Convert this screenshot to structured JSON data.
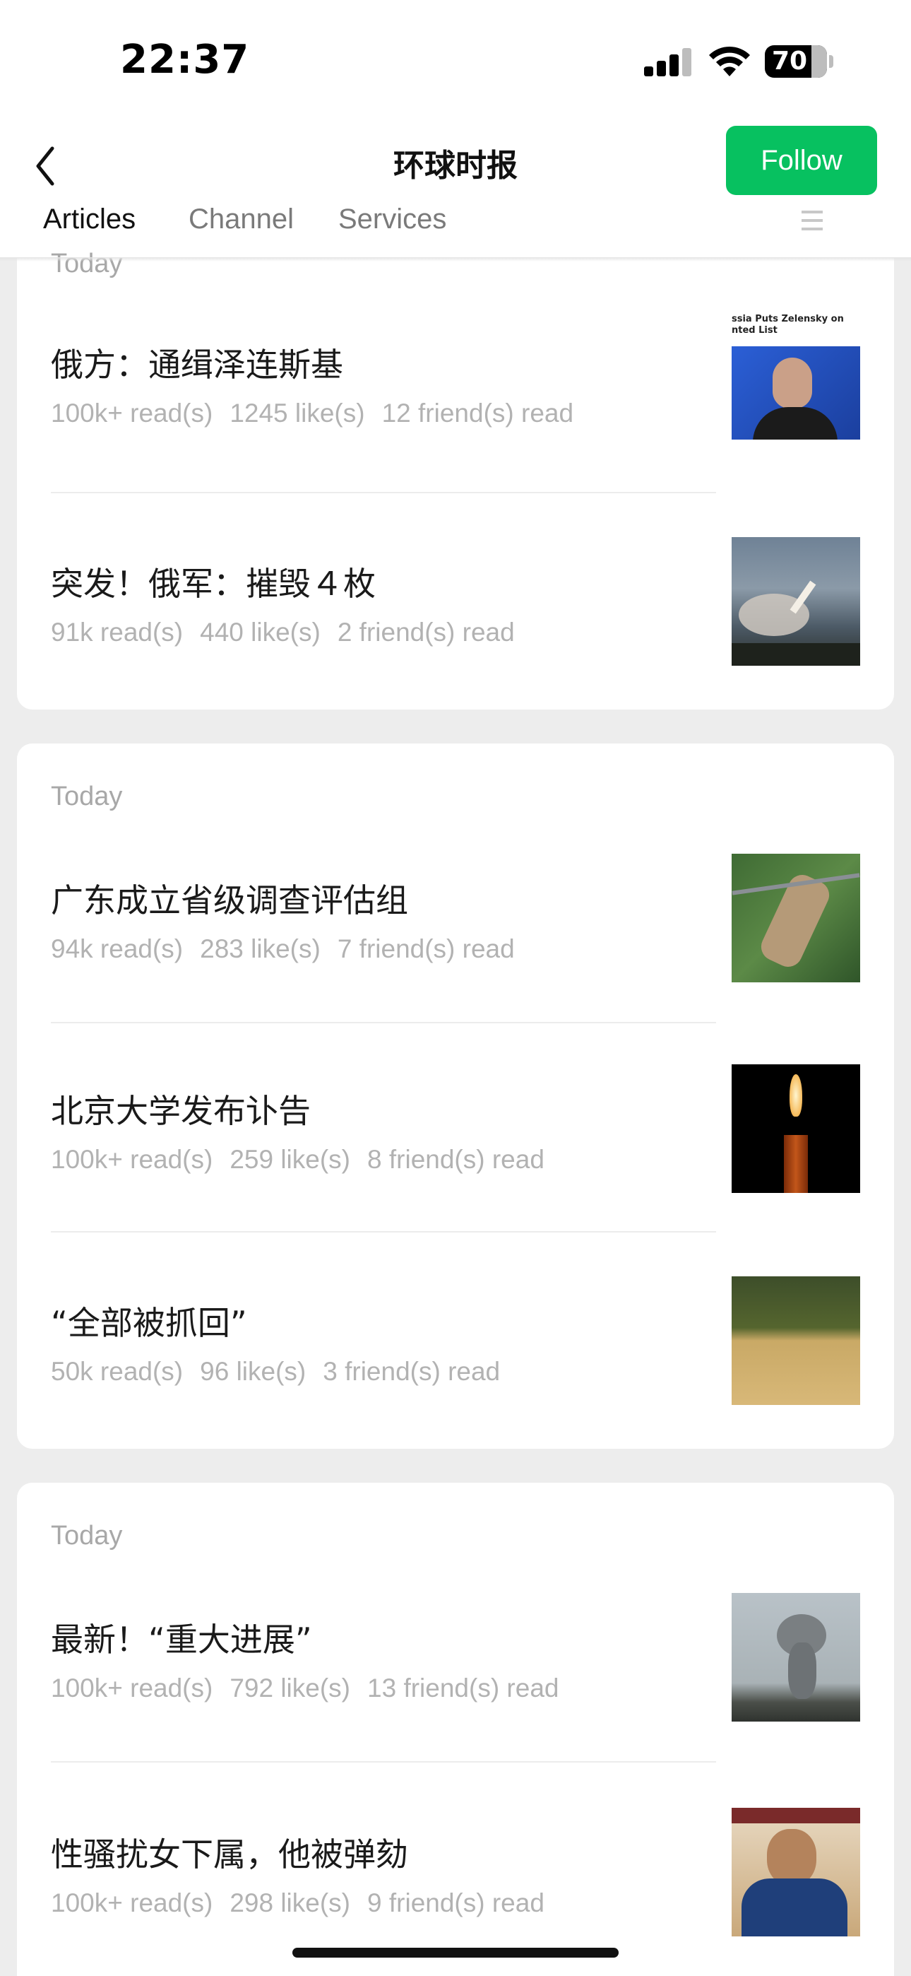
{
  "status": {
    "time": "22:37",
    "battery": "70"
  },
  "nav": {
    "title": "环球时报",
    "follow_label": "Follow",
    "tabs": [
      {
        "label": "Articles"
      },
      {
        "label": "Channel"
      },
      {
        "label": "Services"
      }
    ]
  },
  "groups": [
    {
      "label": "Today",
      "articles": [
        {
          "title": "俄方：通缉泽连斯基",
          "reads": "100k+ read(s)",
          "likes": "1245 like(s)",
          "friends": "12 friend(s) read",
          "thumb_caption": "ssia Puts Zelensky on\nnted List"
        },
        {
          "title": "突发！俄军：摧毁４枚",
          "reads": "91k read(s)",
          "likes": "440 like(s)",
          "friends": "2 friend(s) read"
        }
      ]
    },
    {
      "label": "Today",
      "articles": [
        {
          "title": "广东成立省级调查评估组",
          "reads": "94k read(s)",
          "likes": "283 like(s)",
          "friends": "7 friend(s) read"
        },
        {
          "title": "北京大学发布讣告",
          "reads": "100k+ read(s)",
          "likes": "259 like(s)",
          "friends": "8 friend(s) read"
        },
        {
          "title": "“全部被抓回”",
          "reads": "50k read(s)",
          "likes": "96 like(s)",
          "friends": "3 friend(s) read"
        }
      ]
    },
    {
      "label": "Today",
      "articles": [
        {
          "title": "最新！“重大进展”",
          "reads": "100k+ read(s)",
          "likes": "792 like(s)",
          "friends": "13 friend(s) read"
        },
        {
          "title": "性骚扰女下属，他被弹劾",
          "reads": "100k+ read(s)",
          "likes": "298 like(s)",
          "friends": "9 friend(s) read"
        }
      ]
    }
  ],
  "colors": {
    "accent": "#07c160",
    "background": "#ededed",
    "meta_text": "#b2b2b2"
  }
}
